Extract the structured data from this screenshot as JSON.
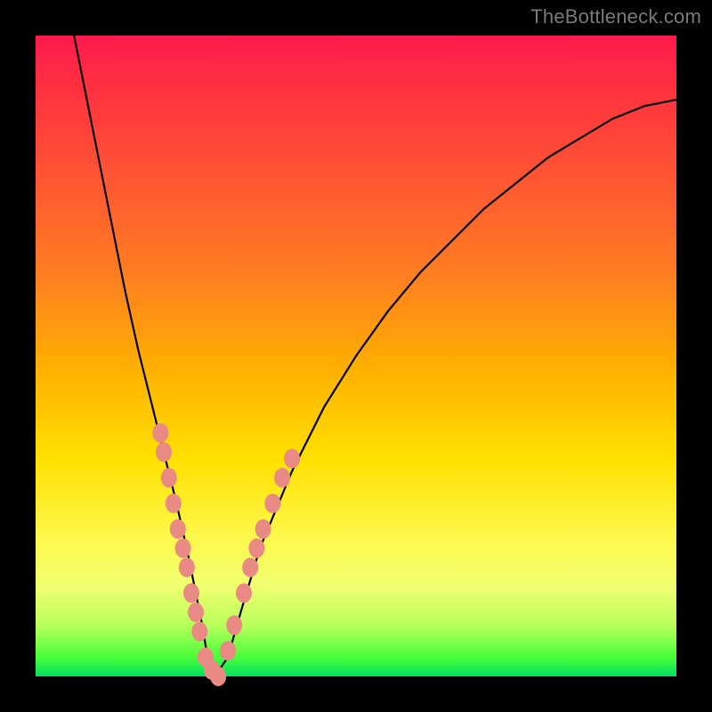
{
  "watermark": "TheBottleneck.com",
  "chart_data": {
    "type": "line",
    "title": "",
    "xlabel": "",
    "ylabel": "",
    "xlim": [
      0,
      100
    ],
    "ylim": [
      0,
      100
    ],
    "background_gradient": {
      "direction": "top-to-bottom",
      "stops": [
        {
          "pos": 0,
          "color": "#ff1a4d"
        },
        {
          "pos": 22,
          "color": "#ff5533"
        },
        {
          "pos": 52,
          "color": "#ffb000"
        },
        {
          "pos": 78,
          "color": "#fff84a"
        },
        {
          "pos": 100,
          "color": "#00e060"
        }
      ]
    },
    "series": [
      {
        "name": "bottleneck-curve",
        "color": "#000000",
        "x": [
          6,
          8,
          10,
          12,
          14,
          16,
          18,
          20,
          22,
          24,
          26,
          27,
          28,
          30,
          32,
          35,
          40,
          45,
          50,
          55,
          60,
          65,
          70,
          75,
          80,
          85,
          90,
          95,
          100
        ],
        "y": [
          100,
          90,
          80,
          70,
          60,
          51,
          43,
          35,
          27,
          18,
          8,
          2,
          0,
          3,
          10,
          20,
          32,
          42,
          50,
          57,
          63,
          68,
          73,
          77,
          81,
          84,
          87,
          89,
          90
        ]
      }
    ],
    "marker_clusters": [
      {
        "name": "left-branch-markers",
        "color": "#e98b84",
        "points": [
          {
            "x": 19.5,
            "y": 38
          },
          {
            "x": 20.0,
            "y": 35
          },
          {
            "x": 20.8,
            "y": 31
          },
          {
            "x": 21.5,
            "y": 27
          },
          {
            "x": 22.2,
            "y": 23
          },
          {
            "x": 23.0,
            "y": 20
          },
          {
            "x": 23.6,
            "y": 17
          },
          {
            "x": 24.3,
            "y": 13
          },
          {
            "x": 25.0,
            "y": 10
          },
          {
            "x": 25.6,
            "y": 7
          },
          {
            "x": 26.5,
            "y": 3
          },
          {
            "x": 27.5,
            "y": 1
          },
          {
            "x": 28.5,
            "y": 0
          }
        ]
      },
      {
        "name": "right-branch-markers",
        "color": "#e98b84",
        "points": [
          {
            "x": 30.0,
            "y": 4
          },
          {
            "x": 31.0,
            "y": 8
          },
          {
            "x": 32.5,
            "y": 13
          },
          {
            "x": 33.5,
            "y": 17
          },
          {
            "x": 34.5,
            "y": 20
          },
          {
            "x": 35.5,
            "y": 23
          },
          {
            "x": 37.0,
            "y": 27
          },
          {
            "x": 38.5,
            "y": 31
          },
          {
            "x": 40.0,
            "y": 34
          }
        ]
      }
    ]
  }
}
